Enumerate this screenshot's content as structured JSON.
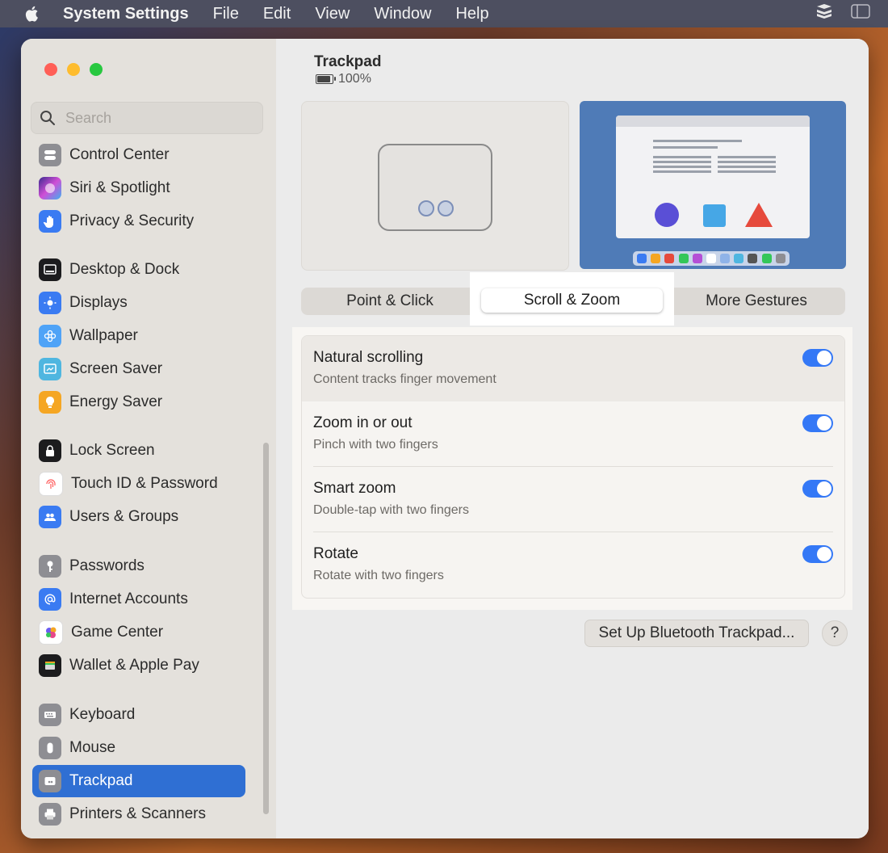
{
  "menubar": {
    "app": "System Settings",
    "items": [
      "File",
      "Edit",
      "View",
      "Window",
      "Help"
    ]
  },
  "sidebar": {
    "search_placeholder": "Search",
    "items": [
      {
        "label": "Control Center",
        "icon": "control-center-icon",
        "color": "#8e8e93"
      },
      {
        "label": "Siri & Spotlight",
        "icon": "siri-icon",
        "color": "#b44fd6"
      },
      {
        "label": "Privacy & Security",
        "icon": "hand-icon",
        "color": "#3a7bf2"
      },
      {
        "label": "Desktop & Dock",
        "icon": "dock-icon",
        "color": "#1c1c1e"
      },
      {
        "label": "Displays",
        "icon": "sun-icon",
        "color": "#3a7bf2"
      },
      {
        "label": "Wallpaper",
        "icon": "flower-icon",
        "color": "#4fa3f7"
      },
      {
        "label": "Screen Saver",
        "icon": "screen-saver-icon",
        "color": "#4fb6e0"
      },
      {
        "label": "Energy Saver",
        "icon": "bulb-icon",
        "color": "#f5a623"
      },
      {
        "label": "Lock Screen",
        "icon": "lock-icon",
        "color": "#1c1c1e"
      },
      {
        "label": "Touch ID & Password",
        "icon": "fingerprint-icon",
        "color": "#ff5e5e"
      },
      {
        "label": "Users & Groups",
        "icon": "users-icon",
        "color": "#3a7bf2"
      },
      {
        "label": "Passwords",
        "icon": "key-icon",
        "color": "#8e8e93"
      },
      {
        "label": "Internet Accounts",
        "icon": "at-icon",
        "color": "#3a7bf2"
      },
      {
        "label": "Game Center",
        "icon": "game-center-icon",
        "color": "#e6478a"
      },
      {
        "label": "Wallet & Apple Pay",
        "icon": "wallet-icon",
        "color": "#1c1c1e"
      },
      {
        "label": "Keyboard",
        "icon": "keyboard-icon",
        "color": "#8e8e93"
      },
      {
        "label": "Mouse",
        "icon": "mouse-icon",
        "color": "#8e8e93"
      },
      {
        "label": "Trackpad",
        "icon": "trackpad-icon",
        "color": "#8e8e93",
        "selected": true
      },
      {
        "label": "Printers & Scanners",
        "icon": "printer-icon",
        "color": "#8e8e93"
      }
    ]
  },
  "header": {
    "title": "Trackpad",
    "battery": "100%"
  },
  "tabs": [
    "Point & Click",
    "Scroll & Zoom",
    "More Gestures"
  ],
  "active_tab": "Scroll & Zoom",
  "settings": [
    {
      "title": "Natural scrolling",
      "subtitle": "Content tracks finger movement",
      "on": true
    },
    {
      "title": "Zoom in or out",
      "subtitle": "Pinch with two fingers",
      "on": true
    },
    {
      "title": "Smart zoom",
      "subtitle": "Double-tap with two fingers",
      "on": true
    },
    {
      "title": "Rotate",
      "subtitle": "Rotate with two fingers",
      "on": true
    }
  ],
  "buttons": {
    "bluetooth": "Set Up Bluetooth Trackpad...",
    "help": "?"
  },
  "colors": {
    "accent": "#3478f6",
    "selected": "#2f6fd3"
  }
}
